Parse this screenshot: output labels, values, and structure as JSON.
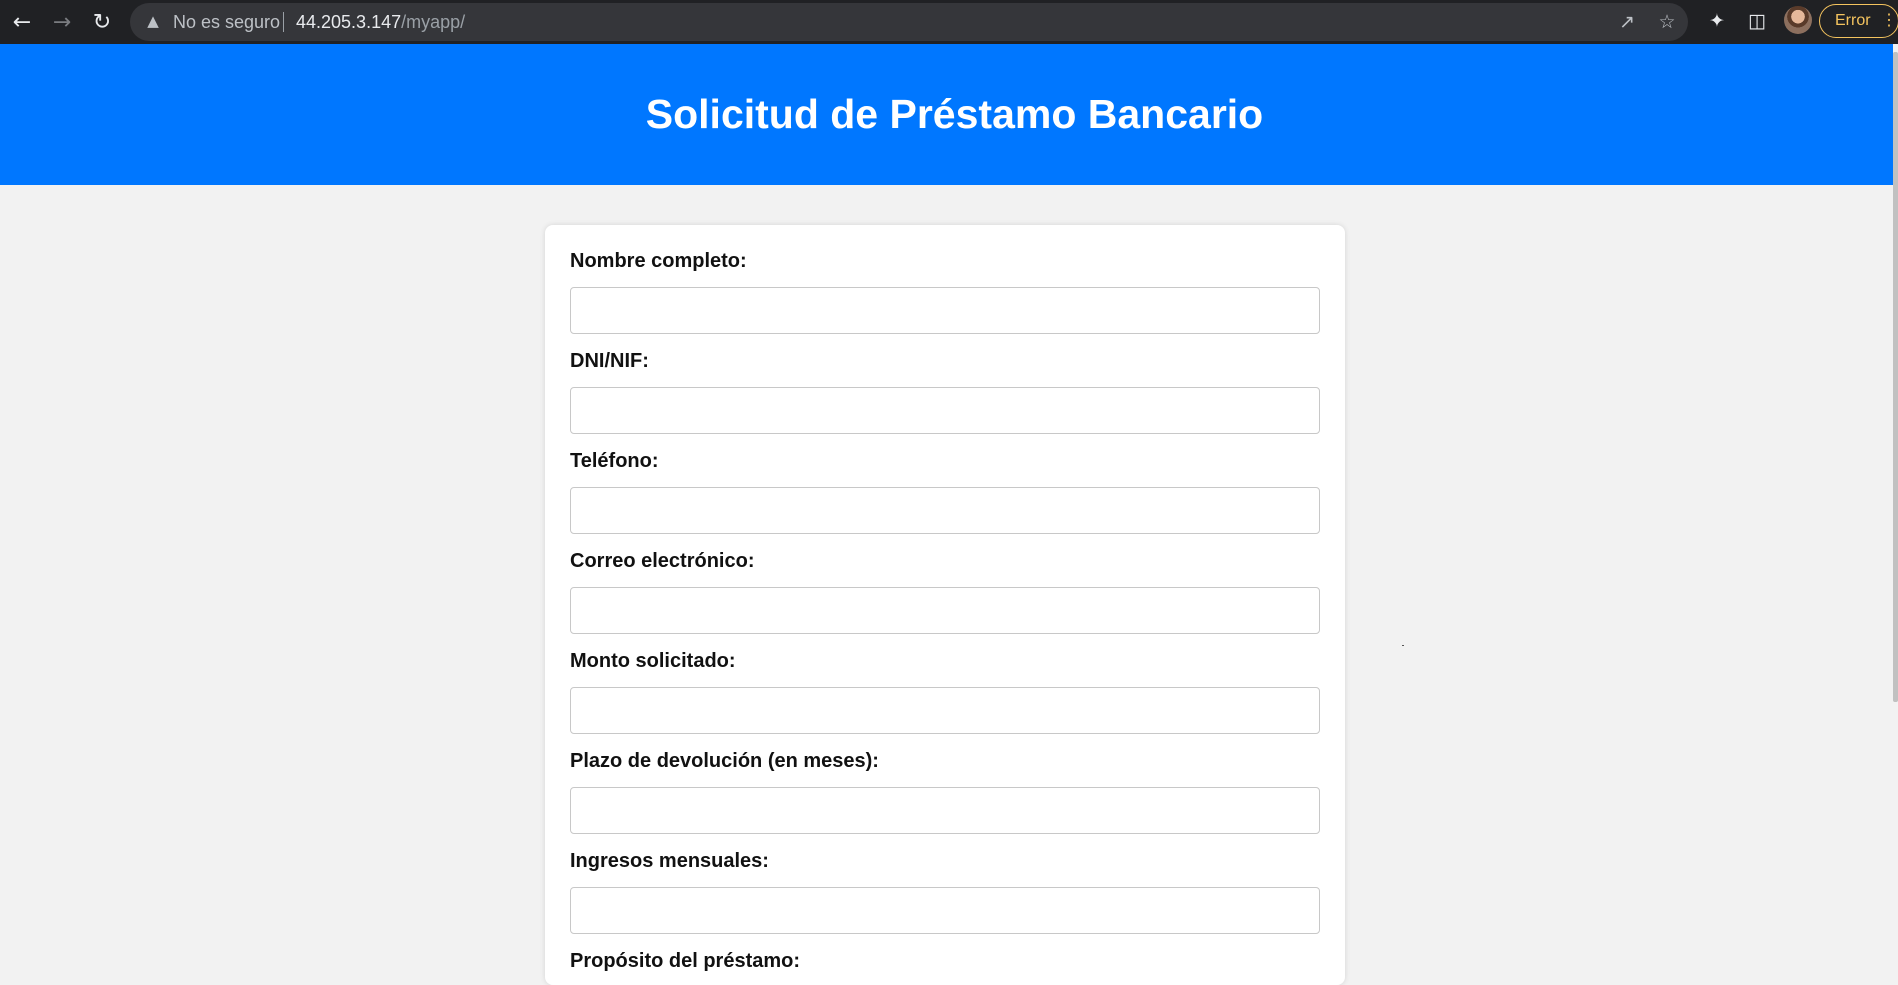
{
  "browser": {
    "back_icon": "arrow-left-icon",
    "forward_icon": "arrow-right-icon",
    "reload_icon": "reload-icon",
    "security_icon": "warning-triangle-icon",
    "security_text": "No es seguro",
    "url_host": "44.205.3.147",
    "url_path": "/myapp/",
    "error_label": "Error"
  },
  "header": {
    "title": "Solicitud de Préstamo Bancario",
    "background_color": "#0077ff"
  },
  "form": {
    "fields": [
      {
        "label": "Nombre completo:",
        "value": ""
      },
      {
        "label": "DNI/NIF:",
        "value": ""
      },
      {
        "label": "Teléfono:",
        "value": ""
      },
      {
        "label": "Correo electrónico:",
        "value": ""
      },
      {
        "label": "Monto solicitado:",
        "value": ""
      },
      {
        "label": "Plazo de devolución (en meses):",
        "value": ""
      },
      {
        "label": "Ingresos mensuales:",
        "value": ""
      },
      {
        "label": "Propósito del préstamo:"
      }
    ]
  }
}
